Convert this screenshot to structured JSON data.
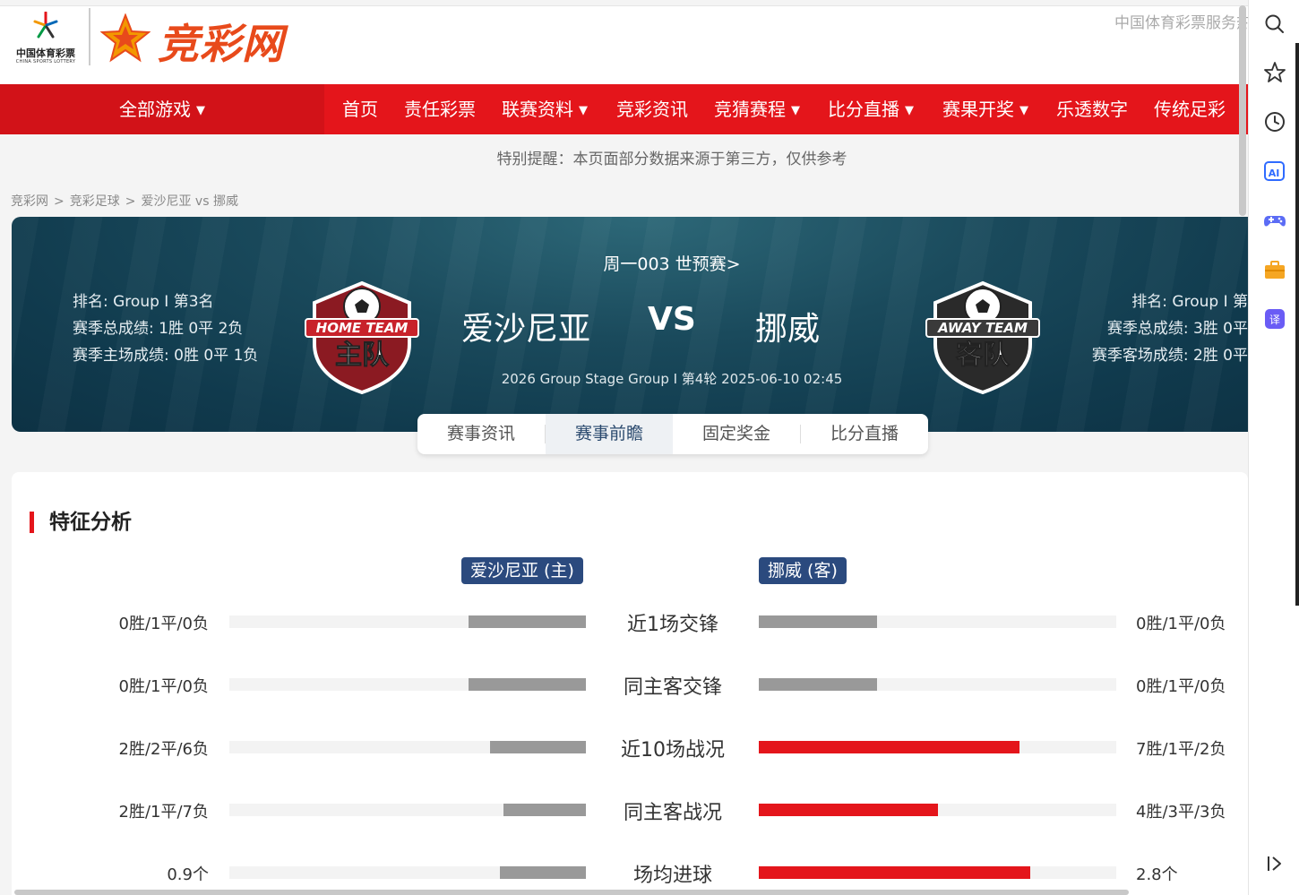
{
  "header": {
    "lottery_logo_text": "中国体育彩票",
    "lottery_logo_en": "CHINA SPORTS LOTTERY",
    "brand_name": "竞彩网",
    "service_text": "中国体育彩票服务热"
  },
  "nav": {
    "all_games": "全部游戏",
    "items": [
      {
        "label": "首页",
        "dropdown": false
      },
      {
        "label": "责任彩票",
        "dropdown": false
      },
      {
        "label": "联赛资料",
        "dropdown": true
      },
      {
        "label": "竞彩资讯",
        "dropdown": false
      },
      {
        "label": "竞猜赛程",
        "dropdown": true
      },
      {
        "label": "比分直播",
        "dropdown": true
      },
      {
        "label": "赛果开奖",
        "dropdown": true
      },
      {
        "label": "乐透数字",
        "dropdown": false
      },
      {
        "label": "传统足彩",
        "dropdown": false
      }
    ]
  },
  "notice": "特别提醒：本页面部分数据来源于第三方，仅供参考",
  "breadcrumb": [
    "竞彩网",
    "竞彩足球",
    "爱沙尼亚 vs 挪威"
  ],
  "match": {
    "label": "周一003 世预赛>",
    "home_name": "爱沙尼亚",
    "vs": "VS",
    "away_name": "挪威",
    "meta": "2026 Group Stage Group I 第4轮 2025-06-10 02:45",
    "home_badge_top": "HOME TEAM",
    "home_badge_main": "主队",
    "away_badge_top": "AWAY TEAM",
    "away_badge_main": "客队",
    "home_stats": [
      "排名: Group I 第3名",
      "赛季总成绩: 1胜 0平 2负",
      "赛季主场成绩: 0胜 0平 1负"
    ],
    "away_stats": [
      "排名: Group I 第",
      "赛季总成绩: 3胜 0平",
      "赛季客场成绩: 2胜 0平"
    ]
  },
  "tabs": [
    {
      "label": "赛事资讯",
      "active": false
    },
    {
      "label": "赛事前瞻",
      "active": true
    },
    {
      "label": "固定奖金",
      "active": false
    },
    {
      "label": "比分直播",
      "active": false
    }
  ],
  "analysis": {
    "title": "特征分析",
    "home_tag": "爱沙尼亚 (主)",
    "away_tag": "挪威 (客)",
    "rows": [
      {
        "label": "近1场交锋",
        "home_value": "0胜/1平/0负",
        "away_value": "0胜/1平/0负",
        "home_share": 0.33,
        "away_share": 0.33,
        "away_highlight": false
      },
      {
        "label": "同主客交锋",
        "home_value": "0胜/1平/0负",
        "away_value": "0胜/1平/0负",
        "home_share": 0.33,
        "away_share": 0.33,
        "away_highlight": false
      },
      {
        "label": "近10场战况",
        "home_value": "2胜/2平/6负",
        "away_value": "7胜/1平/2负",
        "home_share": 0.27,
        "away_share": 0.73,
        "away_highlight": true
      },
      {
        "label": "同主客战况",
        "home_value": "2胜/1平/7负",
        "away_value": "4胜/3平/3负",
        "home_share": 0.23,
        "away_share": 0.5,
        "away_highlight": true
      },
      {
        "label": "场均进球",
        "home_value": "0.9个",
        "away_value": "2.8个",
        "home_share": 0.24,
        "away_share": 0.76,
        "away_highlight": true
      }
    ]
  },
  "colors": {
    "nav_red": "#e4151b",
    "brand_orange": "#e84a1b",
    "tag_blue": "#2b4a7e",
    "bar_grey": "#999999",
    "bar_red": "#e4151b"
  },
  "sidebar_icons": [
    "search-icon",
    "star-icon",
    "history-icon",
    "ai-icon",
    "game-controller-icon",
    "toolbox-icon",
    "translate-icon",
    "expand-sidebar-icon"
  ]
}
